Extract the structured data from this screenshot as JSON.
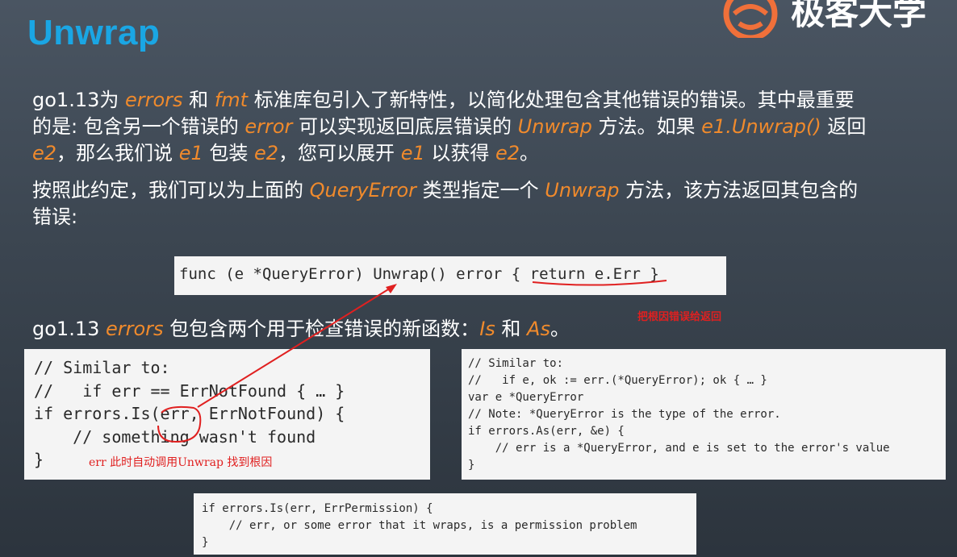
{
  "slide": {
    "title": "Unwrap",
    "logo_text": "极客大学"
  },
  "intro": {
    "p1": [
      {
        "t": "go1.13为 "
      },
      {
        "t": "errors",
        "hl": true
      },
      {
        "t": " 和 "
      },
      {
        "t": "fmt",
        "hl": true
      },
      {
        "t": " 标准库包引入了新特性，以简化处理包含其他错误的错误。其中最重要的是: 包含另一个错误的 "
      },
      {
        "t": "error",
        "hl": true
      },
      {
        "t": " 可以实现返回底层错误的 "
      },
      {
        "t": "Unwrap",
        "hl": true
      },
      {
        "t": " 方法。如果 "
      },
      {
        "t": "e1.Unwrap()",
        "hl": true
      },
      {
        "t": " 返回 "
      },
      {
        "t": "e2",
        "hl": true
      },
      {
        "t": "，那么我们说 "
      },
      {
        "t": "e1",
        "hl": true
      },
      {
        "t": " 包装 "
      },
      {
        "t": "e2",
        "hl": true
      },
      {
        "t": "，您可以展开 "
      },
      {
        "t": "e1",
        "hl": true
      },
      {
        "t": " 以获得 "
      },
      {
        "t": "e2",
        "hl": true
      },
      {
        "t": "。"
      }
    ],
    "p2": [
      {
        "t": "按照此约定，我们可以为上面的 "
      },
      {
        "t": "QueryError",
        "hl": true
      },
      {
        "t": " 类型指定一个 "
      },
      {
        "t": "Unwrap",
        "hl": true
      },
      {
        "t": " 方法，该方法返回其包含的错误:"
      }
    ],
    "p3": [
      {
        "t": "go1.13 "
      },
      {
        "t": "errors",
        "hl": true
      },
      {
        "t": " 包包含两个用于检查错误的新函数："
      },
      {
        "t": "Is",
        "hl": true
      },
      {
        "t": " 和 "
      },
      {
        "t": "As",
        "hl": true
      },
      {
        "t": "。"
      }
    ]
  },
  "code_unwrap": {
    "lines": [
      "func (e *QueryError) Unwrap() error { return e.Err }"
    ]
  },
  "code_is": {
    "lines": [
      "// Similar to:",
      "//   if err == ErrNotFound { … }",
      "if errors.Is(err, ErrNotFound) {",
      "    // something wasn't found",
      "}"
    ]
  },
  "code_as": {
    "lines": [
      "// Similar to:",
      "//   if e, ok := err.(*QueryError); ok { … }",
      "var e *QueryError",
      "// Note: *QueryError is the type of the error.",
      "if errors.As(err, &e) {",
      "    // err is a *QueryError, and e is set to the error's value",
      "}"
    ]
  },
  "code_perm": {
    "lines": [
      "if errors.Is(err, ErrPermission) {",
      "    // err, or some error that it wraps, is a permission problem",
      "}"
    ]
  },
  "annotations": {
    "return_root": "把根因错误给返回",
    "auto_unwrap": "err 此时自动调用Unwrap 找到根因"
  },
  "colors": {
    "title": "#1aa6e4",
    "highlight": "#f08a2c",
    "annotation": "#e02020",
    "code_bg": "#f4f4f4"
  }
}
